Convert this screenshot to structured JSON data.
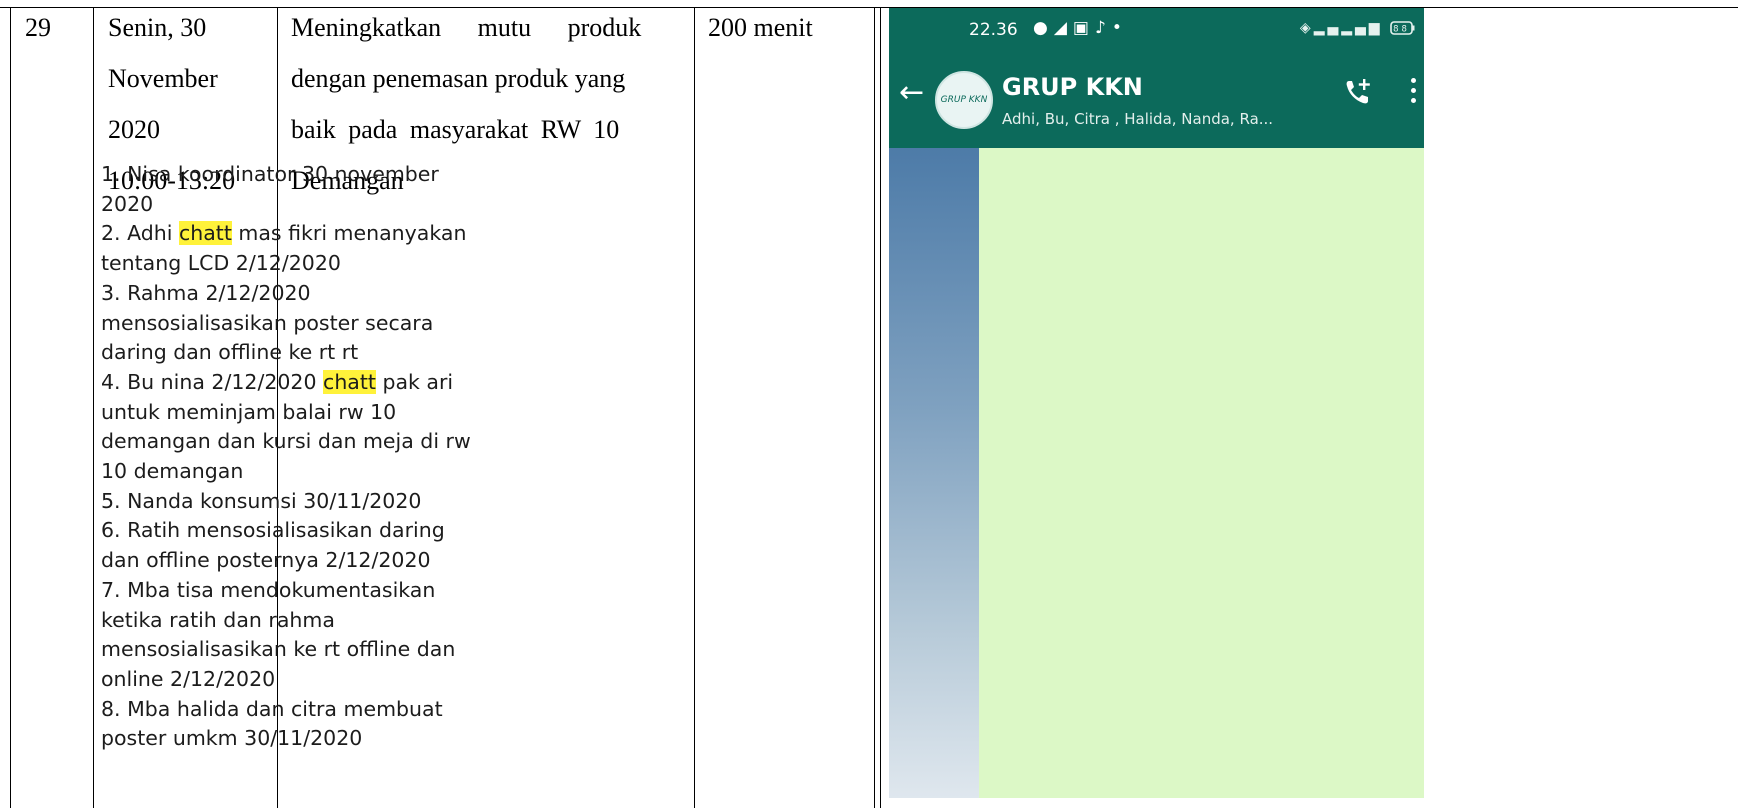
{
  "table": {
    "row": {
      "number": "29",
      "date_lines": [
        "Senin, 30",
        "November",
        "2020",
        "10:00-13:20"
      ],
      "activity_lines": [
        "Meningkatkan mutu produk",
        "dengan penemasan produk yang",
        "baik pada masyarakat RW 10",
        "Demangan"
      ],
      "duration": "200 menit"
    }
  },
  "phone": {
    "status_time": "22.36",
    "status_icons": [
      "chat-bubble-icon",
      "telegram-icon",
      "app-icon",
      "tiktok-icon",
      "dot-icon"
    ],
    "status_right": [
      "vibrate-icon",
      "signal-icon",
      "4g-signal-icon",
      "battery-icon"
    ],
    "battery": "88",
    "chat": {
      "avatar_text": "GRUP KKN",
      "title": "GRUP KKN",
      "members": "Adhi, Bu, Citra , Halida, Nanda, Ra...",
      "message_lines": [
        [
          {
            "t": "1. Nisa koordinator 30 november"
          }
        ],
        [
          {
            "t": "2020"
          }
        ],
        [
          {
            "t": "2. Adhi "
          },
          {
            "t": "chatt",
            "hl": true
          },
          {
            "t": " mas fikri menanyakan"
          }
        ],
        [
          {
            "t": "tentang LCD 2/12/2020"
          }
        ],
        [
          {
            "t": "3. Rahma 2/12/2020"
          }
        ],
        [
          {
            "t": "mensosialisasikan poster secara"
          }
        ],
        [
          {
            "t": "daring dan offline ke rt rt"
          }
        ],
        [
          {
            "t": "4. Bu nina 2/12/2020 "
          },
          {
            "t": "chatt",
            "hl": true
          },
          {
            "t": " pak ari"
          }
        ],
        [
          {
            "t": "untuk meminjam balai rw 10"
          }
        ],
        [
          {
            "t": "demangan dan kursi dan meja di rw"
          }
        ],
        [
          {
            "t": "10 demangan"
          }
        ],
        [
          {
            "t": "5. Nanda konsumsi 30/11/2020"
          }
        ],
        [
          {
            "t": "6. Ratih mensosialisasikan daring"
          }
        ],
        [
          {
            "t": "dan offline posternya 2/12/2020"
          }
        ],
        [
          {
            "t": "7. Mba tisa mendokumentasikan"
          }
        ],
        [
          {
            "t": "ketika ratih dan rahma"
          }
        ],
        [
          {
            "t": "mensosialisasikan ke rt offline dan"
          }
        ],
        [
          {
            "t": "online 2/12/2020"
          }
        ],
        [
          {
            "t": "8. Mba halida dan citra membuat"
          }
        ],
        [
          {
            "t": "poster umkm 30/11/2020"
          }
        ]
      ]
    }
  },
  "colors": {
    "header_green": "#0c6a5b",
    "bubble_green": "#dcf8c6",
    "highlight": "#fff23a"
  }
}
